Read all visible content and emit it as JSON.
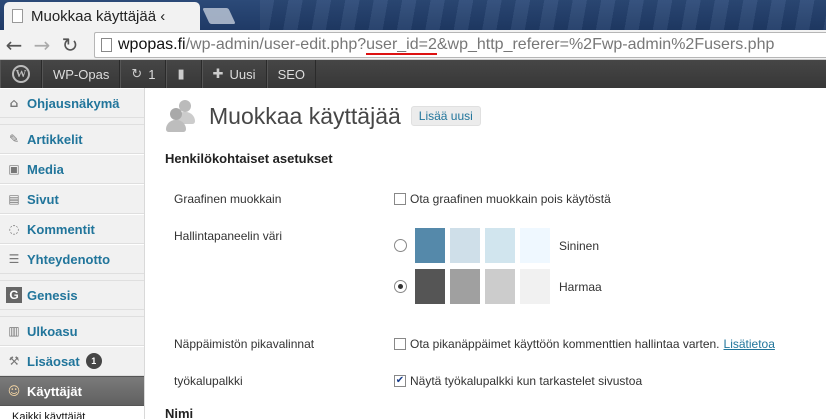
{
  "browser": {
    "tab_title": "Muokkaa käyttäjää ‹",
    "url_host": "wpopas.fi",
    "url_path": "/wp-admin/user-edit.php?",
    "url_highlight": "user_id=2",
    "url_rest": "&wp_http_referer=%2Fwp-admin%2Fusers.php",
    "icons": {
      "back": "back-arrow-icon",
      "forward": "forward-arrow-icon",
      "reload": "reload-icon"
    }
  },
  "adminbar": {
    "site_name": "WP-Opas",
    "updates_count": "1",
    "new_label": "Uusi",
    "seo_label": "SEO"
  },
  "sidebar": {
    "items": [
      {
        "label": "Ohjausnäkymä",
        "icon": "dashboard-icon"
      },
      {
        "label": "Artikkelit",
        "icon": "pin-icon"
      },
      {
        "label": "Media",
        "icon": "media-icon"
      },
      {
        "label": "Sivut",
        "icon": "pages-icon"
      },
      {
        "label": "Kommentit",
        "icon": "comments-icon"
      },
      {
        "label": "Yhteydenotto",
        "icon": "contact-icon"
      },
      {
        "label": "Genesis",
        "icon": "genesis-icon"
      },
      {
        "label": "Ulkoasu",
        "icon": "appearance-icon"
      },
      {
        "label": "Lisäosat",
        "icon": "plugins-icon",
        "badge": "1"
      },
      {
        "label": "Käyttäjät",
        "icon": "users-icon"
      }
    ],
    "submenu": {
      "label": "Kaikki käyttäjät"
    }
  },
  "main": {
    "title": "Muokkaa käyttäjää",
    "add_new": "Lisää uusi",
    "section_personal": "Henkilökohtaiset asetukset",
    "section_name": "Nimi",
    "rows": {
      "visual_editor": {
        "label": "Graafinen muokkain",
        "option": "Ota graafinen muokkain pois käytöstä",
        "checked": false
      },
      "admin_color": {
        "label": "Hallintapaneelin väri"
      },
      "shortcuts": {
        "label": "Näppäimistön pikavalinnat",
        "option": "Ota pikanäppäimet käyttöön kommenttien hallintaa varten.",
        "link": "Lisätietoa",
        "checked": false
      },
      "toolbar": {
        "label": "työkalupalkki",
        "option": "Näytä työkalupalkki kun tarkastelet sivustoa",
        "checked": true
      }
    },
    "color_schemes": [
      {
        "name": "Sininen",
        "selected": false,
        "colors": [
          "#5589aa",
          "#cfdfe9",
          "#d1e5ee",
          "#eff8ff"
        ]
      },
      {
        "name": "Harmaa",
        "selected": true,
        "colors": [
          "#555555",
          "#a0a0a0",
          "#cccccc",
          "#f1f1f1"
        ]
      }
    ]
  }
}
